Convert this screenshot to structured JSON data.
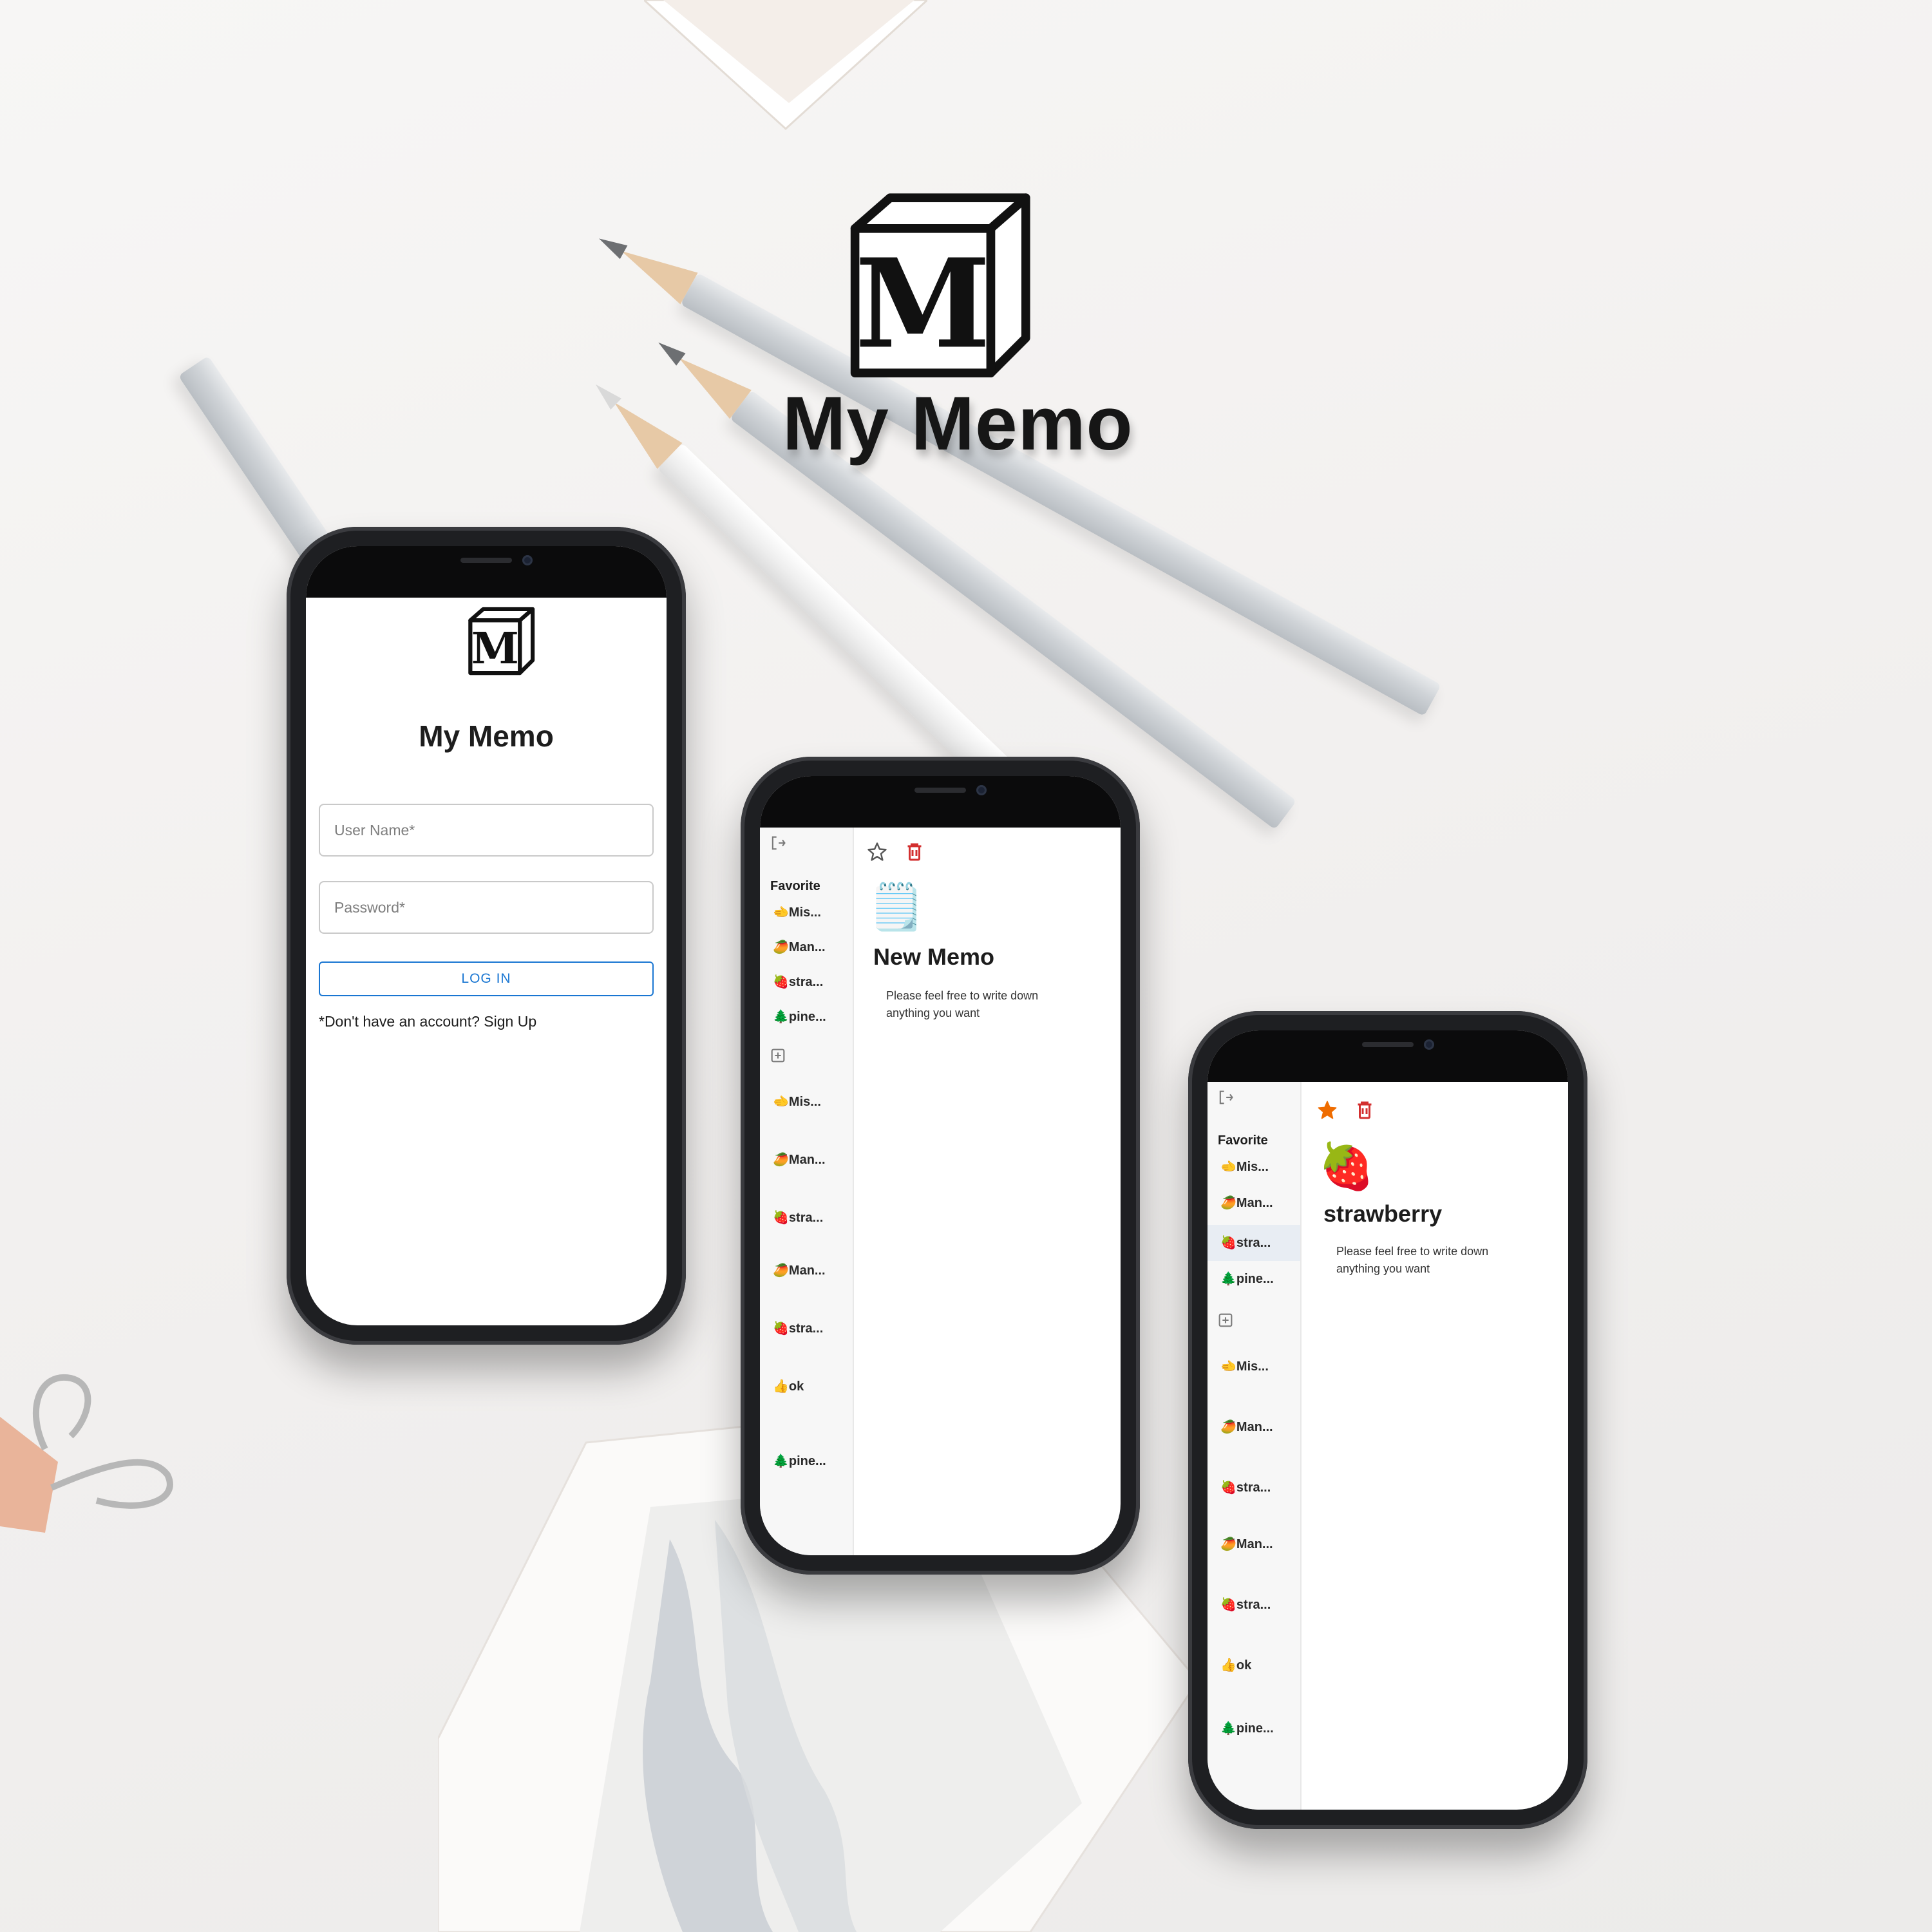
{
  "brand": {
    "title": "My Memo",
    "logo_letter": "M"
  },
  "login": {
    "title": "My Memo",
    "logo_letter": "M",
    "username_placeholder": "User Name*",
    "password_placeholder": "Password*",
    "login_label": "LOG IN",
    "signup_text": "*Don't have an account? Sign Up"
  },
  "memo_screen_1": {
    "favorite_heading": "Favorite",
    "favorites": [
      {
        "emoji": "🫲",
        "label": "Mis..."
      },
      {
        "emoji": "🥭",
        "label": "Man..."
      },
      {
        "emoji": "🍓",
        "label": "stra..."
      },
      {
        "emoji": "🌲",
        "label": "pine..."
      }
    ],
    "memos": [
      {
        "emoji": "🫲",
        "label": "Mis..."
      },
      {
        "emoji": "🥭",
        "label": "Man..."
      },
      {
        "emoji": "🍓",
        "label": "stra..."
      },
      {
        "emoji": "🥭",
        "label": "Man..."
      },
      {
        "emoji": "🍓",
        "label": "stra..."
      },
      {
        "emoji": "👍",
        "label": "ok"
      },
      {
        "emoji": "🌲",
        "label": "pine..."
      }
    ],
    "memo": {
      "emoji": "🗒️",
      "title": "New Memo",
      "body": "Please feel free to write down anything you want",
      "favorited": false
    }
  },
  "memo_screen_2": {
    "favorite_heading": "Favorite",
    "favorites": [
      {
        "emoji": "🫲",
        "label": "Mis..."
      },
      {
        "emoji": "🥭",
        "label": "Man..."
      },
      {
        "emoji": "🍓",
        "label": "stra..."
      },
      {
        "emoji": "🌲",
        "label": "pine..."
      }
    ],
    "memos": [
      {
        "emoji": "🫲",
        "label": "Mis..."
      },
      {
        "emoji": "🥭",
        "label": "Man..."
      },
      {
        "emoji": "🍓",
        "label": "stra..."
      },
      {
        "emoji": "🥭",
        "label": "Man..."
      },
      {
        "emoji": "🍓",
        "label": "stra..."
      },
      {
        "emoji": "👍",
        "label": "ok"
      },
      {
        "emoji": "🌲",
        "label": "pine..."
      }
    ],
    "memo": {
      "emoji": "🍓",
      "title": "strawberry",
      "body": "Please feel free to write down anything you want",
      "favorited": true
    }
  },
  "colors": {
    "accent_blue": "#1976d2",
    "delete_red": "#d32f2f",
    "star_orange": "#ef6c00",
    "active_item": "#e8edf3"
  },
  "icons": [
    "logout-icon",
    "add-page-icon",
    "star-icon",
    "trash-icon",
    "cube-logo-icon"
  ]
}
